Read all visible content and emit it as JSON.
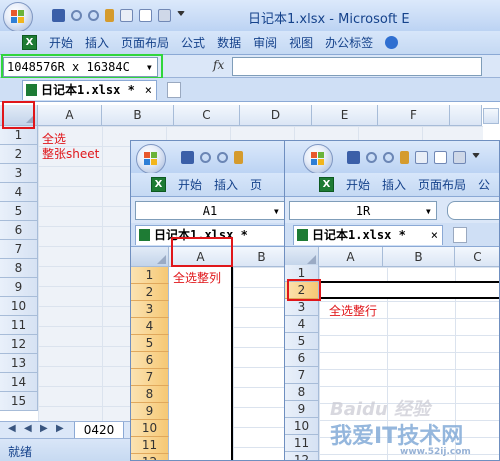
{
  "window_main": {
    "title": "日记本1.xlsx - Microsoft E",
    "ribbon_tabs": [
      "开始",
      "插入",
      "页面布局",
      "公式",
      "数据",
      "审阅",
      "视图",
      "办公标签"
    ],
    "name_box": "1048576R x 16384C",
    "fx": "fx",
    "doc_tab": "日记本1.xlsx *",
    "doc_tab_close": "×",
    "columns": [
      "A",
      "B",
      "C",
      "D",
      "E",
      "F"
    ],
    "rows": [
      "1",
      "2",
      "3",
      "4",
      "5",
      "6",
      "7",
      "8",
      "9",
      "10",
      "11",
      "12",
      "13",
      "14",
      "15"
    ],
    "annotation_line1": "全选",
    "annotation_line2": "整张sheet",
    "sheet_tab": "0420",
    "status": "就绪"
  },
  "window_col": {
    "ribbon_tabs": [
      "开始",
      "插入",
      "页"
    ],
    "name_box": "A1",
    "doc_tab": "日记本1.xlsx *",
    "columns": [
      "A",
      "B"
    ],
    "rows": [
      "1",
      "2",
      "3",
      "4",
      "5",
      "6",
      "7",
      "8",
      "9",
      "10",
      "11",
      "12"
    ],
    "annotation": "全选整列"
  },
  "window_row": {
    "ribbon_tabs": [
      "开始",
      "插入",
      "页面布局",
      "公"
    ],
    "name_box": "1R",
    "doc_tab": "日记本1.xlsx *",
    "doc_tab_close": "×",
    "columns": [
      "A",
      "B",
      "C"
    ],
    "rows": [
      "1",
      "2",
      "3",
      "4",
      "5",
      "6",
      "7",
      "8",
      "9",
      "10",
      "11",
      "12"
    ],
    "annotation": "全选整行"
  },
  "watermark": {
    "baidu": "Baidu 经验",
    "site_name": "我爱IT技术网",
    "site_url": "www.52ij.com"
  },
  "colors": {
    "highlight_red": "#e0161a",
    "highlight_green": "#30d63c",
    "header_orange": "#f6c874",
    "ribbon_blue": "#c5d9f3"
  }
}
